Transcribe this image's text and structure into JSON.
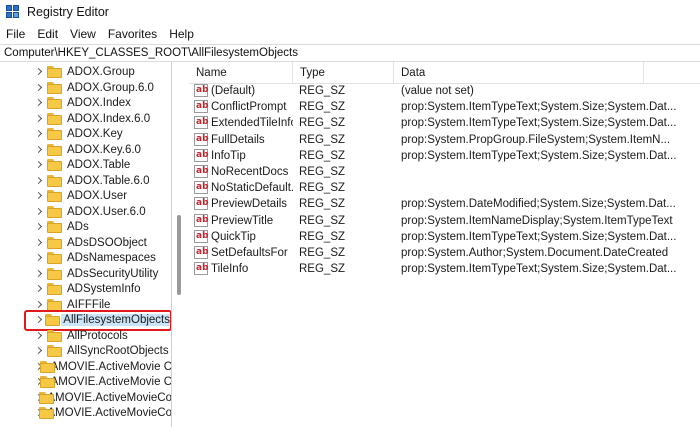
{
  "window": {
    "title": "Registry Editor"
  },
  "menu": [
    "File",
    "Edit",
    "View",
    "Favorites",
    "Help"
  ],
  "address": "Computer\\HKEY_CLASSES_ROOT\\AllFilesystemObjects",
  "tree": {
    "items": [
      "ADOX.Group",
      "ADOX.Group.6.0",
      "ADOX.Index",
      "ADOX.Index.6.0",
      "ADOX.Key",
      "ADOX.Key.6.0",
      "ADOX.Table",
      "ADOX.Table.6.0",
      "ADOX.User",
      "ADOX.User.6.0",
      "ADs",
      "ADsDSOObject",
      "ADsNamespaces",
      "ADsSecurityUtility",
      "ADSystemInfo",
      "AIFFFile",
      "AllFilesystemObjects",
      "AllProtocols",
      "AllSyncRootObjects",
      "AMOVIE.ActiveMovie C",
      "AMOVIE.ActiveMovie C",
      "AMOVIE.ActiveMovieCo",
      "AMOVIE.ActiveMovieCo"
    ],
    "selected": "AllFilesystemObjects"
  },
  "list": {
    "columns": [
      "Name",
      "Type",
      "Data"
    ],
    "rows": [
      {
        "name": "(Default)",
        "type": "REG_SZ",
        "data": "(value not set)"
      },
      {
        "name": "ConflictPrompt",
        "type": "REG_SZ",
        "data": "prop:System.ItemTypeText;System.Size;System.Dat..."
      },
      {
        "name": "ExtendedTileInfo",
        "type": "REG_SZ",
        "data": "prop:System.ItemTypeText;System.Size;System.Dat..."
      },
      {
        "name": "FullDetails",
        "type": "REG_SZ",
        "data": "prop:System.PropGroup.FileSystem;System.ItemN..."
      },
      {
        "name": "InfoTip",
        "type": "REG_SZ",
        "data": "prop:System.ItemTypeText;System.Size;System.Dat..."
      },
      {
        "name": "NoRecentDocs",
        "type": "REG_SZ",
        "data": ""
      },
      {
        "name": "NoStaticDefault...",
        "type": "REG_SZ",
        "data": ""
      },
      {
        "name": "PreviewDetails",
        "type": "REG_SZ",
        "data": "prop:System.DateModified;System.Size;System.Dat..."
      },
      {
        "name": "PreviewTitle",
        "type": "REG_SZ",
        "data": "prop:System.ItemNameDisplay;System.ItemTypeText"
      },
      {
        "name": "QuickTip",
        "type": "REG_SZ",
        "data": "prop:System.ItemTypeText;System.Size;System.Dat..."
      },
      {
        "name": "SetDefaultsFor",
        "type": "REG_SZ",
        "data": "prop:System.Author;System.Document.DateCreated"
      },
      {
        "name": "TileInfo",
        "type": "REG_SZ",
        "data": "prop:System.ItemTypeText;System.Size;System.Dat..."
      }
    ]
  },
  "icons": {
    "app": "registry-editor-icon",
    "tree_expander": "chevron-right-icon",
    "tree_folder": "folder-icon",
    "value": "string-value-icon",
    "value_glyph": "ab"
  },
  "colors": {
    "highlight": "#e0191c",
    "folder": "#f7c843",
    "value_icon_text": "#c0262d"
  }
}
